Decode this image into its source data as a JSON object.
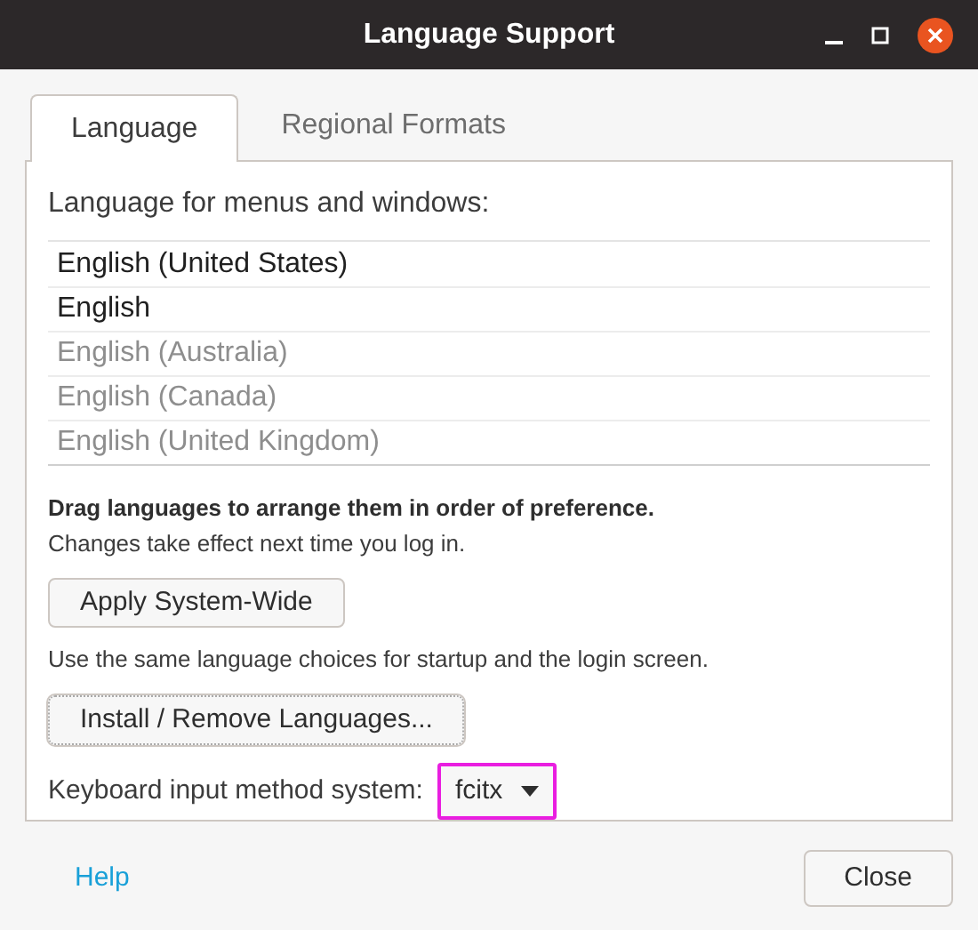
{
  "window": {
    "title": "Language Support"
  },
  "tabs": [
    {
      "label": "Language",
      "selected": true
    },
    {
      "label": "Regional Formats",
      "selected": false
    }
  ],
  "language_section": {
    "heading": "Language for menus and windows:",
    "languages": [
      {
        "name": "English (United States)",
        "enabled": true
      },
      {
        "name": "English",
        "enabled": true
      },
      {
        "name": "English (Australia)",
        "enabled": false
      },
      {
        "name": "English (Canada)",
        "enabled": false
      },
      {
        "name": "English (United Kingdom)",
        "enabled": false
      }
    ],
    "hint_bold": "Drag languages to arrange them in order of preference.",
    "hint": "Changes take effect next time you log in.",
    "apply_button": "Apply System-Wide",
    "apply_note": "Use the same language choices for startup and the login screen.",
    "install_button": "Install / Remove Languages...",
    "input_method": {
      "label": "Keyboard input method system:",
      "value": "fcitx",
      "highlighted": true
    }
  },
  "footer": {
    "help_link": "Help",
    "close_button": "Close"
  }
}
